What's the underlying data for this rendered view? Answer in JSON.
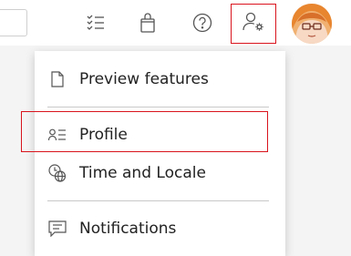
{
  "topbar": {
    "icons": [
      "task-list-icon",
      "shopping-bag-icon",
      "help-icon",
      "user-settings-icon"
    ]
  },
  "menu": {
    "items": [
      {
        "label": "Preview features",
        "icon": "document-icon"
      },
      {
        "label": "Profile",
        "icon": "profile-list-icon"
      },
      {
        "label": "Time and Locale",
        "icon": "clock-globe-icon"
      },
      {
        "label": "Notifications",
        "icon": "chat-icon"
      }
    ]
  },
  "colors": {
    "highlight": "#d9141d"
  }
}
